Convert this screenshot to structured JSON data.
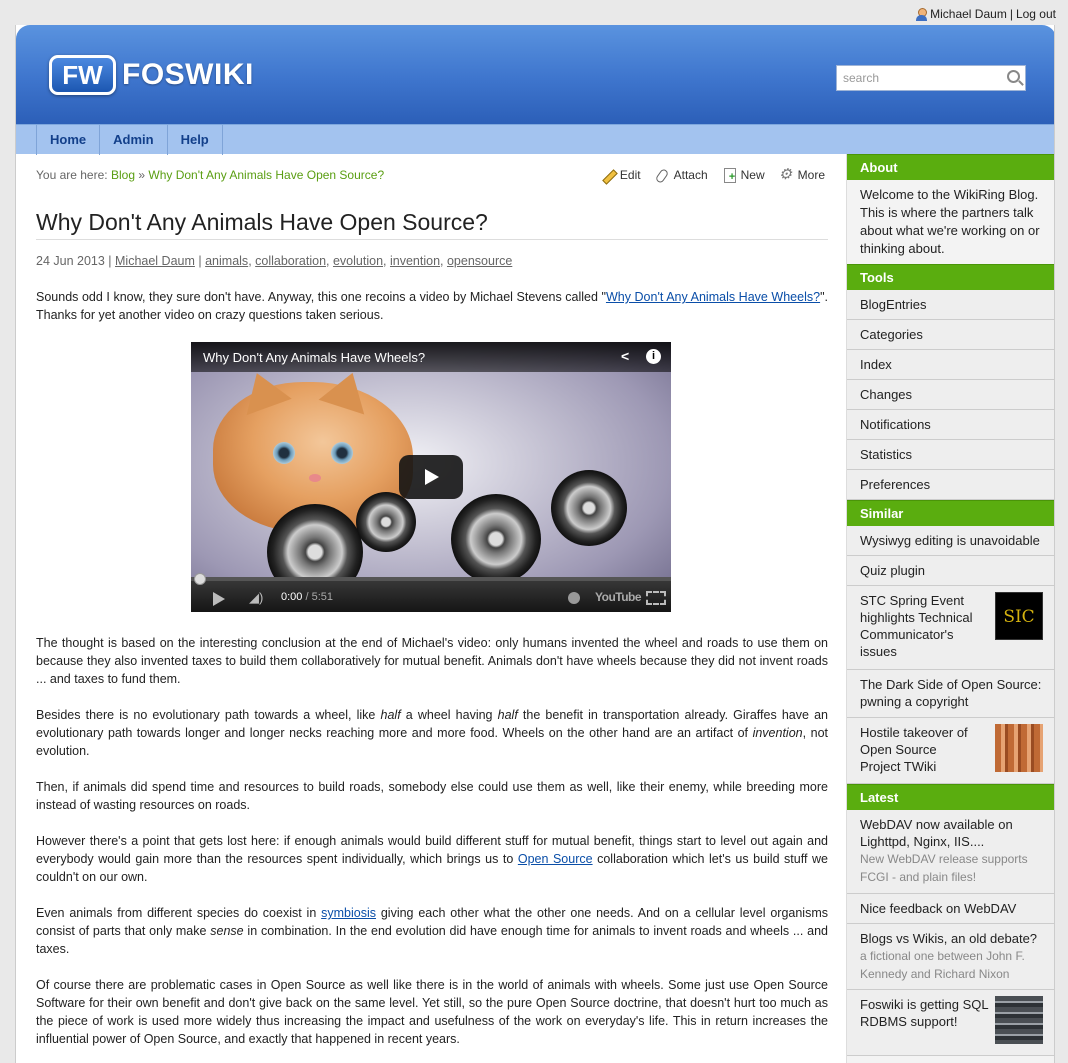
{
  "userbar": {
    "user": "Michael Daum",
    "separator": "|",
    "logout": "Log out"
  },
  "header": {
    "logo_badge": "FW",
    "logo_text": "FOSWIKI",
    "search_placeholder": "search"
  },
  "nav": {
    "items": [
      "Home",
      "Admin",
      "Help"
    ]
  },
  "breadcrumb": {
    "prefix": "You are here:",
    "blog": "Blog",
    "sep": "»",
    "current": "Why Don't Any Animals Have Open Source?"
  },
  "actions": {
    "edit": "Edit",
    "attach": "Attach",
    "new": "New",
    "more": "More"
  },
  "post": {
    "title": "Why Don't Any Animals Have Open Source?",
    "date": "24 Jun 2013",
    "author": "Michael Daum",
    "tags": [
      "animals",
      "collaboration",
      "evolution",
      "invention",
      "opensource"
    ],
    "intro_before": "Sounds odd I know, they sure don't have. Anyway, this one recoins a video by Michael Stevens called \"",
    "intro_link": "Why Don't Any Animals Have Wheels?",
    "intro_after": "\". Thanks for yet another video on crazy questions taken serious.",
    "p1": "The thought is based on the interesting conclusion at the end of Michael's video: only humans invented the wheel and roads to use them on because they also invented taxes to build them collaboratively for mutual benefit. Animals don't have wheels because they did not invent roads ... and taxes to fund them.",
    "p2_a": "Besides there is no evolutionary path towards a wheel, like ",
    "p2_em1": "half",
    "p2_b": " a wheel having ",
    "p2_em2": "half",
    "p2_c": " the benefit in transportation already. Giraffes have an evolutionary path towards longer and longer necks reaching more and more food. Wheels on the other hand are an artifact of ",
    "p2_em3": "invention",
    "p2_d": ", not evolution.",
    "p3": "Then, if animals did spend time and resources to build roads, somebody else could use them as well, like their enemy, while breeding more instead of wasting resources on roads.",
    "p4_a": "However there's a point that gets lost here: if enough animals would build different stuff for mutual benefit, things start to level out again and everybody would gain more than the resources spent individually, which brings us to ",
    "p4_link": "Open Source",
    "p4_b": " collaboration which let's us build stuff we couldn't on our own.",
    "p5_a": "Even animals from different species do coexist in ",
    "p5_link": "symbiosis",
    "p5_b": " giving each other what the other one needs. And on a cellular level organisms consist of parts that only make ",
    "p5_em": "sense",
    "p5_c": " in combination. In the end evolution did have enough time for animals to invent roads and wheels ... and taxes.",
    "p6": "Of course there are problematic cases in Open Source as well like there is in the world of animals with wheels. Some just use Open Source Software for their own benefit and don't give back on the same level. Yet still, so the pure Open Source doctrine, that doesn't hurt too much as the piece of work is used more widely thus increasing the impact and usefulness of the work on everyday's life. This in return increases the influential power of Open Source, and exactly that happened in recent years."
  },
  "video": {
    "title": "Why Don't Any Animals Have Wheels?",
    "time": "0:00",
    "duration": "/ 5:51",
    "brand": "YouTube"
  },
  "sidebar": {
    "about_h": "About",
    "about_text": "Welcome to the WikiRing Blog. This is where the partners talk about what we're working on or thinking about.",
    "tools_h": "Tools",
    "tools": [
      "BlogEntries",
      "Categories",
      "Index",
      "Changes",
      "Notifications",
      "Statistics",
      "Preferences"
    ],
    "similar_h": "Similar",
    "similar": [
      "Wysiwyg editing is unavoidable",
      "Quiz plugin",
      "STC Spring Event highlights Technical Communicator's issues",
      "The Dark Side of Open Source: pwning a copyright",
      "Hostile takeover of Open Source Project TWiki"
    ],
    "stc_thumb_text": "SIC",
    "latest_h": "Latest",
    "latest": [
      {
        "title": "WebDAV now available on Lighttpd, Nginx, IIS....",
        "sub": "New WebDAV release supports FCGI - and plain files!"
      },
      {
        "title": "Nice feedback on WebDAV",
        "sub": ""
      },
      {
        "title": "Blogs vs Wikis, an old debate?",
        "sub": "a fictional one between John F. Kennedy and Richard Nixon"
      },
      {
        "title": "Foswiki is getting SQL RDBMS support!",
        "sub": ""
      }
    ]
  }
}
